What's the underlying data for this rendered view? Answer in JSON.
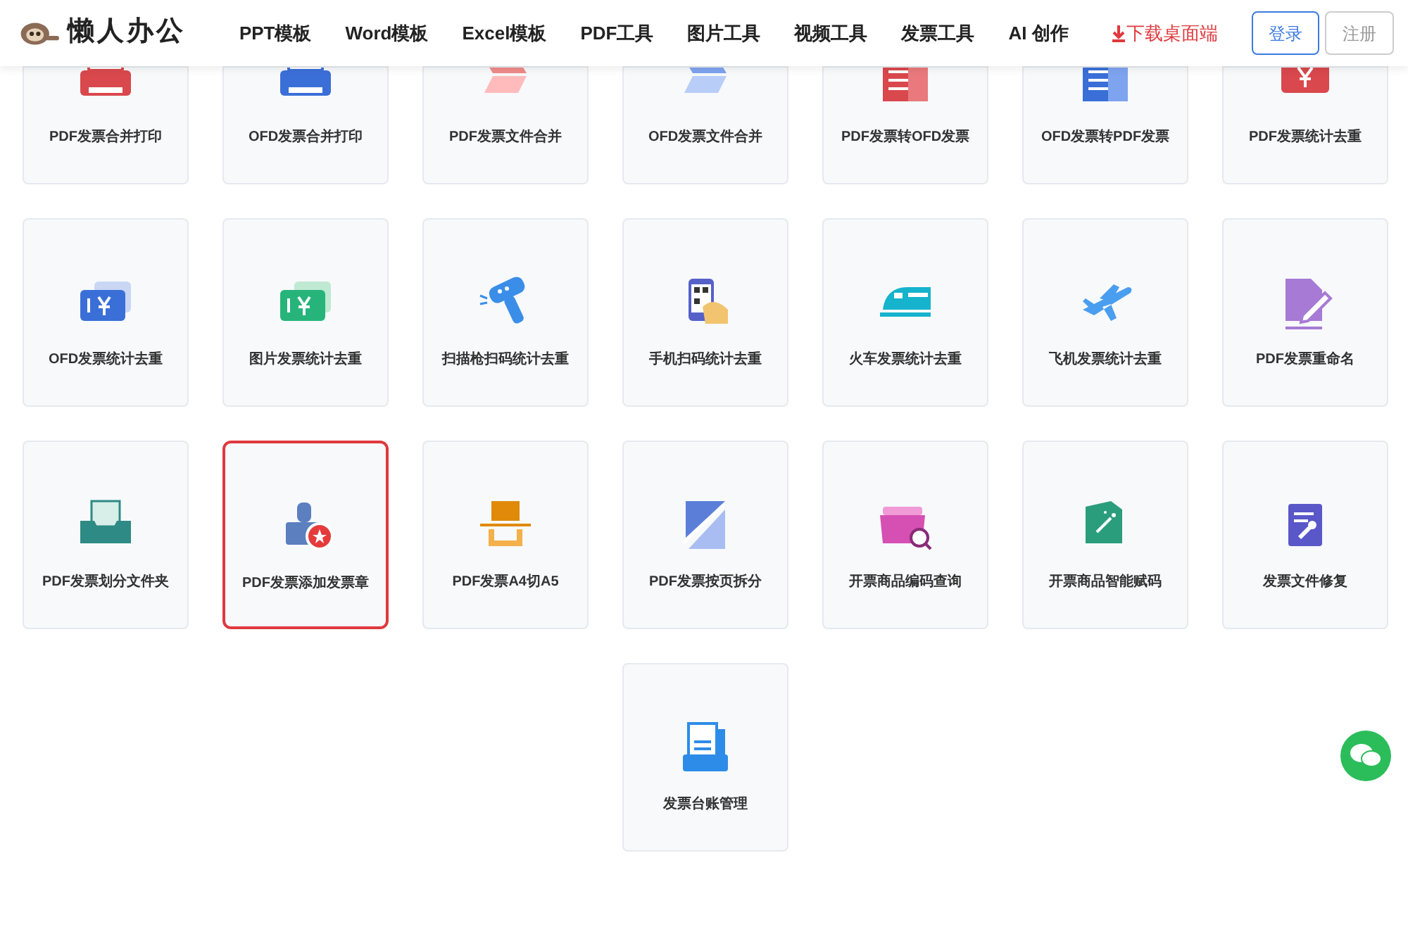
{
  "header": {
    "logo": "懒人办公",
    "nav": [
      "PPT模板",
      "Word模板",
      "Excel模板",
      "PDF工具",
      "图片工具",
      "视频工具",
      "发票工具",
      "AI 创作"
    ],
    "download": "下载桌面端",
    "login": "登录",
    "register": "注册"
  },
  "cards": [
    {
      "label": "PDF发票合并打印",
      "kind": "printer-red",
      "selected": false
    },
    {
      "label": "OFD发票合并打印",
      "kind": "printer-blue",
      "selected": false
    },
    {
      "label": "PDF发票文件合并",
      "kind": "merge-red",
      "selected": false
    },
    {
      "label": "OFD发票文件合并",
      "kind": "merge-blue",
      "selected": false
    },
    {
      "label": "PDF发票转OFD发票",
      "kind": "convert-red",
      "selected": false
    },
    {
      "label": "OFD发票转PDF发票",
      "kind": "convert-blue",
      "selected": false
    },
    {
      "label": "PDF发票统计去重",
      "kind": "ticket-red",
      "selected": false
    },
    {
      "label": "OFD发票统计去重",
      "kind": "ticket-blue",
      "selected": false
    },
    {
      "label": "图片发票统计去重",
      "kind": "ticket-green",
      "selected": false
    },
    {
      "label": "扫描枪扫码统计去重",
      "kind": "scanner",
      "selected": false
    },
    {
      "label": "手机扫码统计去重",
      "kind": "phone",
      "selected": false
    },
    {
      "label": "火车发票统计去重",
      "kind": "train",
      "selected": false
    },
    {
      "label": "飞机发票统计去重",
      "kind": "plane",
      "selected": false
    },
    {
      "label": "PDF发票重命名",
      "kind": "rename",
      "selected": false
    },
    {
      "label": "PDF发票划分文件夹",
      "kind": "tray",
      "selected": false
    },
    {
      "label": "PDF发票添加发票章",
      "kind": "stamp",
      "selected": true
    },
    {
      "label": "PDF发票A4切A5",
      "kind": "cut",
      "selected": false
    },
    {
      "label": "PDF发票按页拆分",
      "kind": "split",
      "selected": false
    },
    {
      "label": "开票商品编码查询",
      "kind": "search-box",
      "selected": false
    },
    {
      "label": "开票商品智能赋码",
      "kind": "wand",
      "selected": false
    },
    {
      "label": "发票文件修复",
      "kind": "repair",
      "selected": false
    },
    {
      "label": "发票台账管理",
      "kind": "ledger",
      "selected": false
    }
  ]
}
